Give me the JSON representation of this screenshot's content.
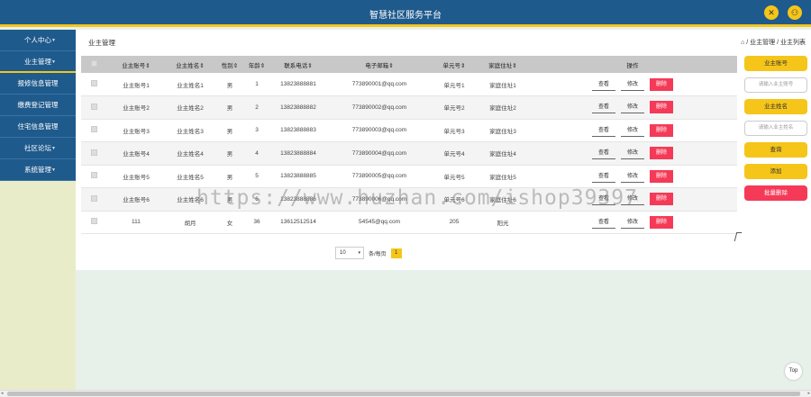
{
  "header": {
    "title": "智慧社区服务平台",
    "tools_icon": "✕",
    "user_icon": "⚇"
  },
  "sidebar": {
    "items": [
      {
        "label": "个人中心",
        "caret": "▼"
      },
      {
        "label": "业主管理",
        "caret": "▼"
      },
      {
        "label": "报修信息管理",
        "caret": ""
      },
      {
        "label": "缴费登记管理",
        "caret": ""
      },
      {
        "label": "住宅信息管理",
        "caret": ""
      },
      {
        "label": "社区论坛",
        "caret": "▼"
      },
      {
        "label": "系统管理",
        "caret": "▼"
      }
    ]
  },
  "main": {
    "page_title": "业主管理",
    "breadcrumb": "⌂ / 业主管理 / 业主列表"
  },
  "table": {
    "headers": [
      "",
      "业主账号⇕",
      "业主姓名⇕",
      "性别⇕",
      "年龄⇕",
      "联系电话⇕",
      "电子邮箱⇕",
      "单元号⇕",
      "家庭住址⇕",
      "操作"
    ],
    "rows": [
      [
        "业主账号1",
        "业主姓名1",
        "男",
        "1",
        "13823888881",
        "773890001@qq.com",
        "单元号1",
        "家庭住址1"
      ],
      [
        "业主账号2",
        "业主姓名2",
        "男",
        "2",
        "13823888882",
        "773890002@qq.com",
        "单元号2",
        "家庭住址2"
      ],
      [
        "业主账号3",
        "业主姓名3",
        "男",
        "3",
        "13823888883",
        "773890003@qq.com",
        "单元号3",
        "家庭住址3"
      ],
      [
        "业主账号4",
        "业主姓名4",
        "男",
        "4",
        "13823888884",
        "773890004@qq.com",
        "单元号4",
        "家庭住址4"
      ],
      [
        "业主账号5",
        "业主姓名5",
        "男",
        "5",
        "13823888885",
        "773890005@qq.com",
        "单元号5",
        "家庭住址5"
      ],
      [
        "业主账号6",
        "业主姓名6",
        "男",
        "6",
        "13823888886",
        "773890006@qq.com",
        "单元号6",
        "家庭住址6"
      ],
      [
        "111",
        "胡月",
        "女",
        "36",
        "13612512514",
        "54545@qq.com",
        "205",
        "阳光"
      ]
    ],
    "actions": {
      "view": "查看",
      "edit": "修改",
      "delete": "删除"
    }
  },
  "pager": {
    "page_size": "10",
    "page_size_suffix": "条/每页",
    "current_page": "1",
    "arrow": "▾"
  },
  "right_panel": {
    "owner_account_label": "业主账号",
    "owner_account_placeholder": "请输入业主账号",
    "owner_name_label": "业主姓名",
    "owner_name_placeholder": "请输入业主姓名",
    "search": "查询",
    "add": "添加",
    "batch_delete": "批量删除"
  },
  "misc": {
    "top_button": "Top",
    "watermark": "https://www.huzhan.com/ishop39397"
  },
  "colors": {
    "primary": "#1f5a8c",
    "accent": "#f5c51a",
    "danger": "#f53a58"
  }
}
